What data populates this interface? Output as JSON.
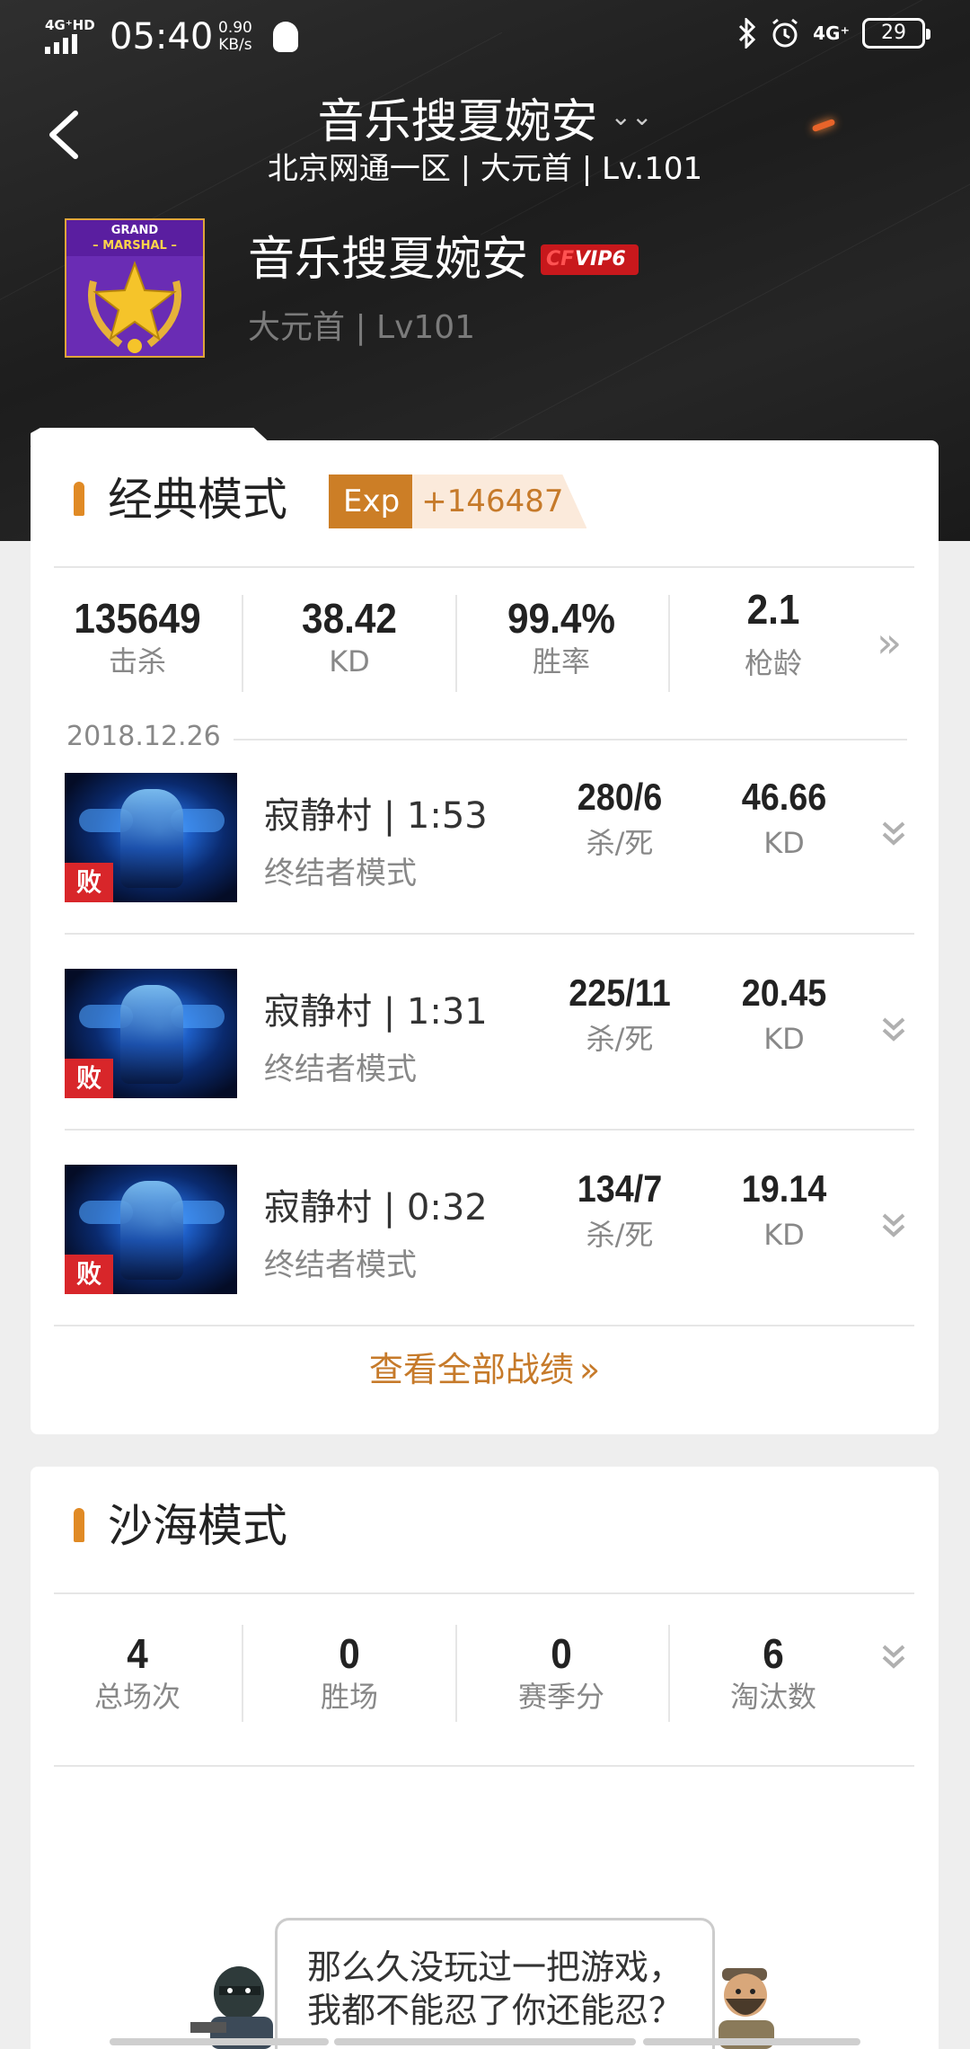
{
  "status_bar": {
    "network": "4G⁺HD",
    "time": "05:40",
    "speed_value": "0.90",
    "speed_unit": "KB/s",
    "network_right": "4G⁺",
    "battery": "29"
  },
  "nav": {
    "title": "音乐搜夏婉安",
    "title_chevron": "chevron-down-icon",
    "subtitle": "北京网通一区 | 大元首 | Lv.101"
  },
  "profile": {
    "badge_line1": "GRAND",
    "badge_line2": "– MARSHAL –",
    "name": "音乐搜夏婉安",
    "vip": "VIP6",
    "sub": "大元首 | Lv101"
  },
  "classic": {
    "title": "经典模式",
    "exp_label": "Exp",
    "exp_value": "+146487",
    "stats": [
      {
        "value": "135649",
        "label": "击杀"
      },
      {
        "value": "38.42",
        "label": "KD"
      },
      {
        "value": "99.4%",
        "label": "胜率"
      },
      {
        "value": "2.1",
        "label": "枪龄"
      }
    ],
    "more_icon": "double-chevron-right-icon",
    "date": "2018.12.26",
    "matches": [
      {
        "result": "败",
        "map": "寂静村 | 1:53",
        "mode": "终结者模式",
        "kd_ratio": "280/6",
        "kd_ratio_label": "杀/死",
        "kd": "46.66",
        "kd_label": "KD"
      },
      {
        "result": "败",
        "map": "寂静村 | 1:31",
        "mode": "终结者模式",
        "kd_ratio": "225/11",
        "kd_ratio_label": "杀/死",
        "kd": "20.45",
        "kd_label": "KD"
      },
      {
        "result": "败",
        "map": "寂静村 | 0:32",
        "mode": "终结者模式",
        "kd_ratio": "134/7",
        "kd_ratio_label": "杀/死",
        "kd": "19.14",
        "kd_label": "KD"
      }
    ],
    "view_all": "查看全部战绩"
  },
  "desert": {
    "title": "沙海模式",
    "stats": [
      {
        "value": "4",
        "label": "总场次"
      },
      {
        "value": "0",
        "label": "胜场"
      },
      {
        "value": "0",
        "label": "赛季分"
      },
      {
        "value": "6",
        "label": "淘汰数"
      }
    ]
  },
  "bubble_text": "那么久没玩过一把游戏，我都不能忍了你还能忍？",
  "colors": {
    "accent": "#c67a2a",
    "exp_badge": "#cc7e26",
    "lose_tag": "#d8262a",
    "header_bg": "#262626"
  }
}
